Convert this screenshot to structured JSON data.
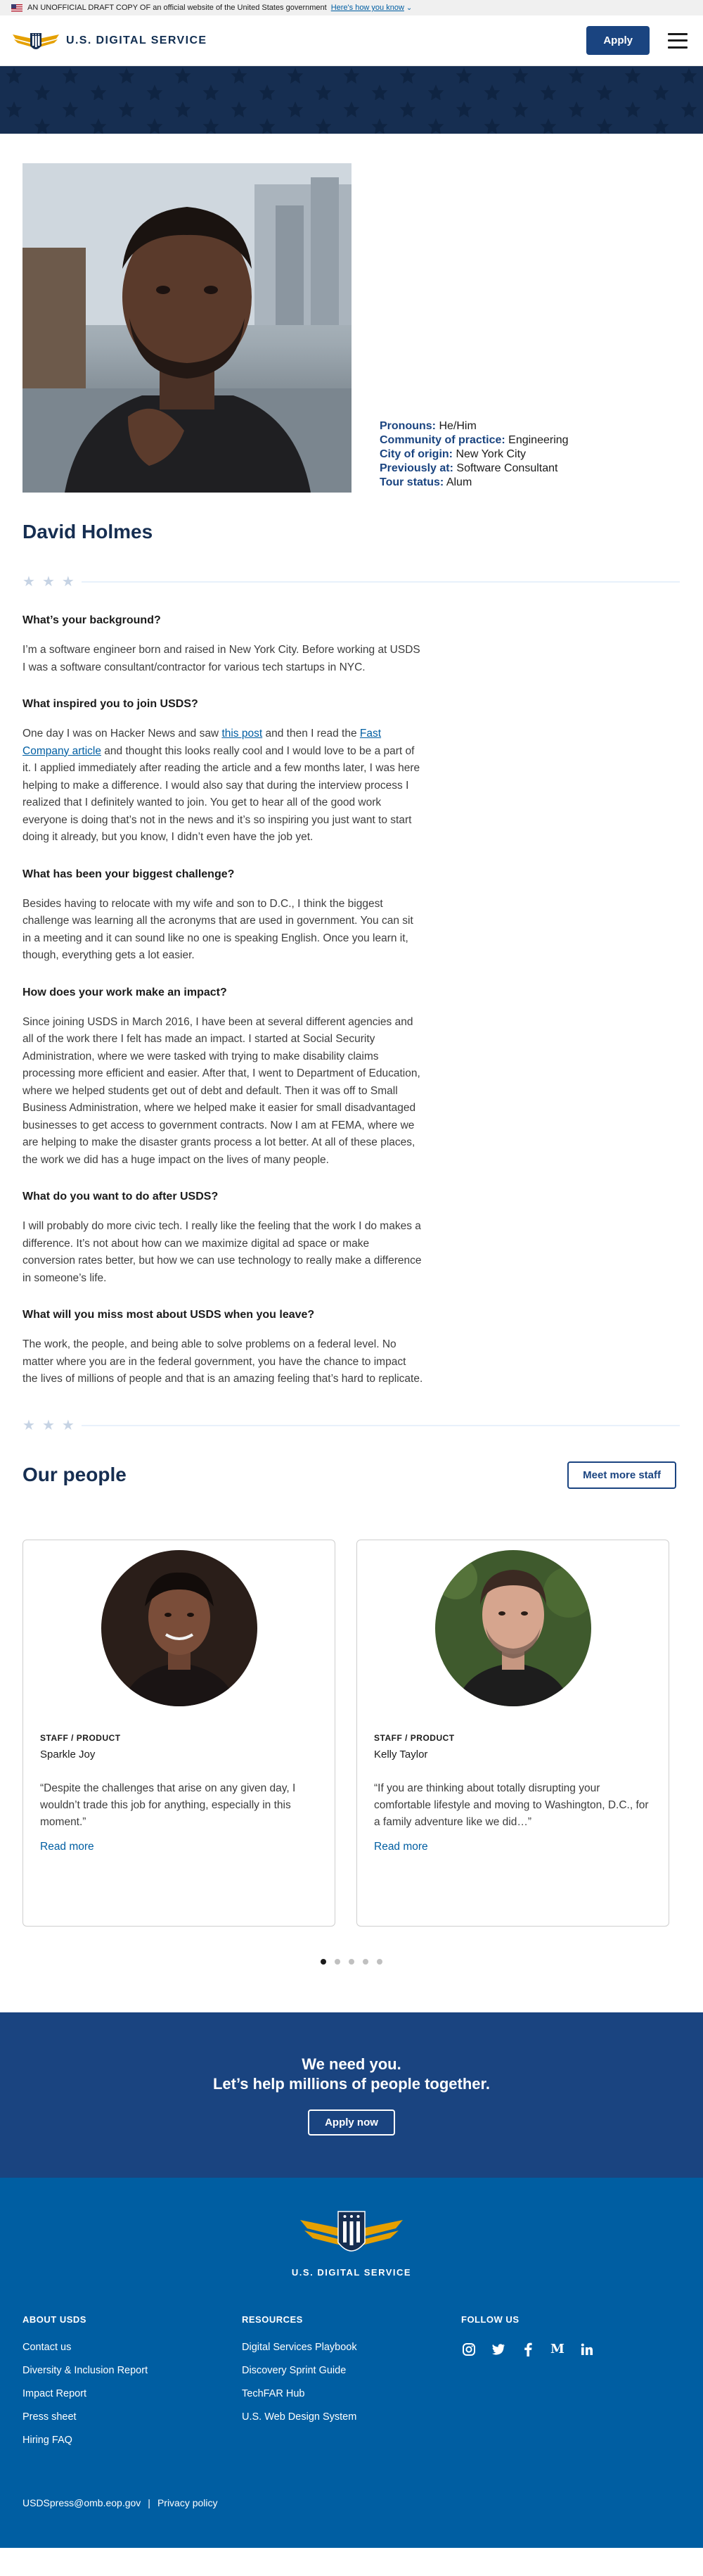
{
  "gov_banner": {
    "text": "AN UNOFFICIAL DRAFT COPY OF an official website of the United States government",
    "link": "Here's how you know"
  },
  "header": {
    "logo_text": "U.S. DIGITAL SERVICE",
    "apply_label": "Apply"
  },
  "profile": {
    "name": "David Holmes",
    "facts": [
      {
        "label": "Pronouns:",
        "value": "He/Him"
      },
      {
        "label": "Community of practice:",
        "value": "Engineering"
      },
      {
        "label": "City of origin:",
        "value": "New York City"
      },
      {
        "label": "Previously at:",
        "value": "Software Consultant"
      },
      {
        "label": "Tour status:",
        "value": "Alum"
      }
    ]
  },
  "qa": {
    "q1": "What’s your background?",
    "a1": "I’m a software engineer born and raised in New York City. Before working at USDS I was a software consultant/contractor for various tech startups in NYC.",
    "q2": "What inspired you to join USDS?",
    "a2_pre": "One day I was on Hacker News and saw ",
    "a2_link1": "this post",
    "a2_mid": " and then I read the ",
    "a2_link2": "Fast Company article",
    "a2_post": " and thought this looks really cool and I would love to be a part of it. I applied immediately after reading the article and a few months later, I was here helping to make a difference. I would also say that during the interview process I realized that I definitely wanted to join. You get to hear all of the good work everyone is doing that’s not in the news and it’s so inspiring you just want to start doing it already, but you know, I didn’t even have the job yet.",
    "q3": "What has been your biggest challenge?",
    "a3": "Besides having to relocate with my wife and son to D.C., I think the biggest challenge was learning all the acronyms that are used in government. You can sit in a meeting and it can sound like no one is speaking English. Once you learn it, though, everything gets a lot easier.",
    "q4": "How does your work make an impact?",
    "a4": "Since joining USDS in March 2016, I have been at several different agencies and all of the work there I felt has made an impact. I started at Social Security Administration, where we were tasked with trying to make disability claims processing more efficient and easier. After that, I went to Department of Education, where we helped students get out of debt and default. Then it was off to Small Business Administration, where we helped make it easier for small disadvantaged businesses to get access to government contracts. Now I am at FEMA, where we are helping to make the disaster grants process a lot better. At all of these places, the work we did has a huge impact on the lives of many people.",
    "q5": "What do you want to do after USDS?",
    "a5": "I will probably do more civic tech. I really like the feeling that the work I do makes a difference. It’s not about how can we maximize digital ad space or make conversion rates better, but how we can use technology to really make a difference in someone’s life.",
    "q6": "What will you miss most about USDS when you leave?",
    "a6": "The work, the people, and being able to solve problems on a federal level. No matter where you are in the federal government, you have the chance to impact the lives of millions of people and that is an amazing feeling that’s hard to replicate."
  },
  "people": {
    "title": "Our people",
    "meet_more": "Meet more staff",
    "cards": [
      {
        "role": "STAFF / PRODUCT",
        "name": "Sparkle Joy",
        "quote": "“Despite the challenges that arise on any given day, I wouldn’t trade this job for anything, especially in this moment.”",
        "read_more": "Read more"
      },
      {
        "role": "STAFF / PRODUCT",
        "name": "Kelly Taylor",
        "quote": "“If you are thinking about totally disrupting your comfortable lifestyle and moving to Washington, D.C., for a family adventure like we did…”",
        "read_more": "Read more"
      }
    ],
    "carousel_pages": 5,
    "carousel_active": 1
  },
  "cta": {
    "line1": "We need you.",
    "line2": "Let’s help millions of people together.",
    "button": "Apply now"
  },
  "footer": {
    "logo_text": "U.S. DIGITAL SERVICE",
    "about_title": "ABOUT USDS",
    "about_links": [
      "Contact us",
      "Diversity & Inclusion Report",
      "Impact Report",
      "Press sheet",
      "Hiring FAQ"
    ],
    "resources_title": "RESOURCES",
    "resources_links": [
      "Digital Services Playbook",
      "Discovery Sprint Guide",
      "TechFAR Hub",
      "U.S. Web Design System"
    ],
    "follow_title": "FOLLOW US",
    "social": [
      "instagram-icon",
      "twitter-icon",
      "facebook-icon",
      "medium-icon",
      "linkedin-icon"
    ],
    "email": "USDSpress@omb.eop.gov",
    "separator": "|",
    "privacy": "Privacy policy"
  },
  "colors": {
    "navy": "#162e51",
    "primary": "#1a4480",
    "link": "#005ea2",
    "footer": "#005ea2",
    "gold": "#e5a000"
  }
}
